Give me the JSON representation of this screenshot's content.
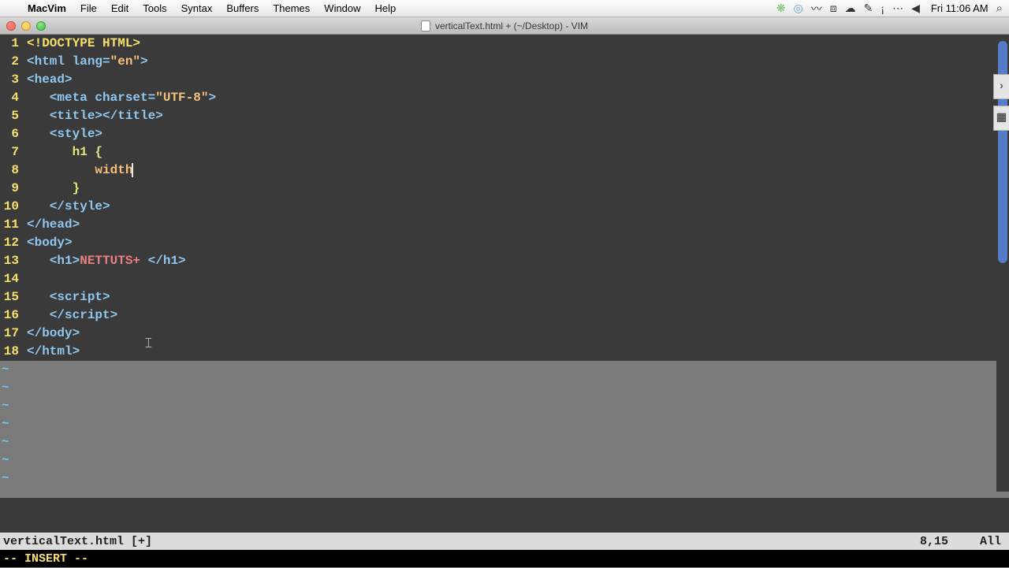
{
  "menubar": {
    "app": "MacVim",
    "items": [
      "File",
      "Edit",
      "Tools",
      "Syntax",
      "Buffers",
      "Themes",
      "Window",
      "Help"
    ],
    "clock": "Fri 11:06 AM"
  },
  "window": {
    "title": "verticalText.html + (~/Desktop) - VIM"
  },
  "editor": {
    "lines_count": 18,
    "cursor_line": 8,
    "cursor_col": 15,
    "tokens": {
      "doctype": "<!DOCTYPE HTML>",
      "html_open1": "<html ",
      "lang_attr": "lang=",
      "lang_val": "\"en\"",
      "html_open2": ">",
      "head_open": "<head>",
      "meta1": "<meta ",
      "charset_attr": "charset=",
      "charset_val": "\"UTF-8\"",
      "meta2": ">",
      "title_open": "<title>",
      "title_close": "</title>",
      "style_open": "<style>",
      "sel": "h1 ",
      "obrace": "{",
      "prop": "width",
      "cbrace": "}",
      "style_close": "</style>",
      "head_close": "</head>",
      "body_open": "<body>",
      "h1_open": "<h1>",
      "h1_text": "NETTUTS+ ",
      "h1_close": "</h1>",
      "script_open": "<script>",
      "script_close": "</script>",
      "body_close": "</body>",
      "html_close": "</html>"
    }
  },
  "status": {
    "file": "verticalText.html [+]",
    "pos": "8,15",
    "view": "All"
  },
  "mode": "-- INSERT --"
}
